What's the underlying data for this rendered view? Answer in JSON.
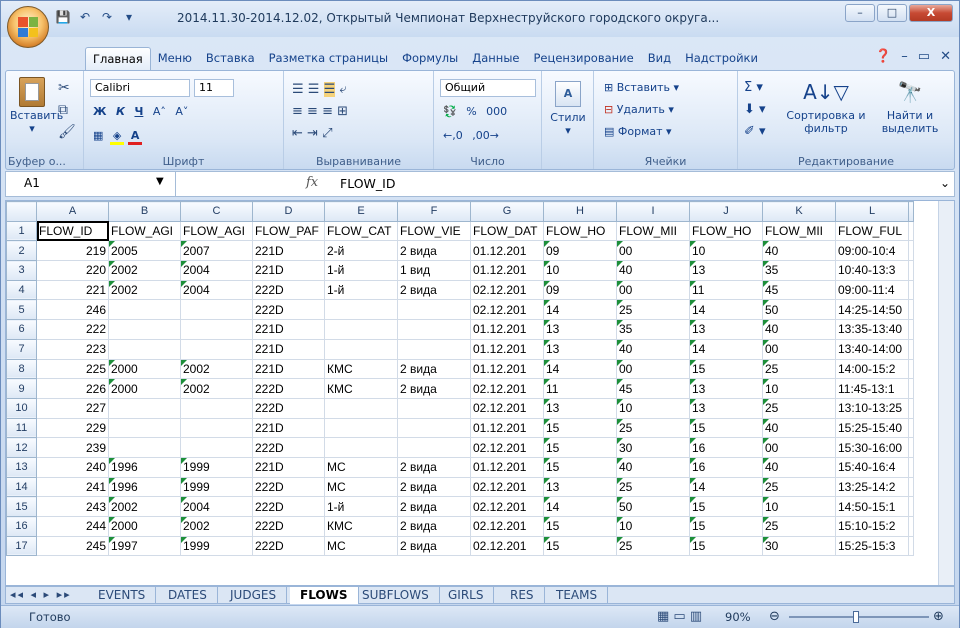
{
  "window": {
    "title": "2014.11.30-2014.12.02, Открытый Чемпионат Верхнеструйского городского округа...",
    "min": "–",
    "max": "□",
    "close": "X"
  },
  "qat": {
    "save": "💾",
    "undo": "↶",
    "redo": "↷",
    "more": "▾"
  },
  "ribbon_tabs": [
    "Главная",
    "Меню",
    "Вставка",
    "Разметка страницы",
    "Формулы",
    "Данные",
    "Рецензирование",
    "Вид",
    "Надстройки"
  ],
  "ribbon": {
    "clipboard": {
      "paste": "Вставить",
      "label": "Буфер о..."
    },
    "font": {
      "name": "Calibri",
      "size": "11",
      "bold": "Ж",
      "italic": "К",
      "underline": "Ч",
      "grow": "A˄",
      "shrink": "A˅",
      "label": "Шрифт"
    },
    "align": {
      "label": "Выравнивание"
    },
    "number": {
      "format": "Общий",
      "percent": "%",
      "thousands": "000",
      "label": "Число"
    },
    "styles": {
      "label": "Стили"
    },
    "cells": {
      "insert": "Вставить",
      "delete": "Удалить",
      "format": "Формат",
      "label": "Ячейки"
    },
    "edit": {
      "sum": "Σ",
      "sort": "Сортировка и фильтр",
      "find": "Найти и выделить",
      "label": "Редактирование"
    }
  },
  "formula_bar": {
    "name_box": "A1",
    "fx": "fx",
    "value": "FLOW_ID"
  },
  "columns": [
    "A",
    "B",
    "C",
    "D",
    "E",
    "F",
    "G",
    "H",
    "I",
    "J",
    "K",
    "L"
  ],
  "header_row": [
    "FLOW_ID",
    "FLOW_AGI",
    "FLOW_AGI",
    "FLOW_PAF",
    "FLOW_CAT",
    "FLOW_VIE",
    "FLOW_DAT",
    "FLOW_HO",
    "FLOW_MII",
    "FLOW_HO",
    "FLOW_MII",
    "FLOW_FUL"
  ],
  "rows": [
    [
      "219",
      "2005",
      "2007",
      "221D",
      "2-й",
      "2 вида",
      "01.12.201",
      "09",
      "00",
      "10",
      "40",
      "09:00-10:4"
    ],
    [
      "220",
      "2002",
      "2004",
      "221D",
      "1-й",
      "1 вид",
      "01.12.201",
      "10",
      "40",
      "13",
      "35",
      "10:40-13:3"
    ],
    [
      "221",
      "2002",
      "2004",
      "222D",
      "1-й",
      "2 вида",
      "02.12.201",
      "09",
      "00",
      "11",
      "45",
      "09:00-11:4"
    ],
    [
      "246",
      "",
      "",
      "222D",
      "",
      "",
      "02.12.201",
      "14",
      "25",
      "14",
      "50",
      "14:25-14:50"
    ],
    [
      "222",
      "",
      "",
      "221D",
      "",
      "",
      "01.12.201",
      "13",
      "35",
      "13",
      "40",
      "13:35-13:40"
    ],
    [
      "223",
      "",
      "",
      "221D",
      "",
      "",
      "01.12.201",
      "13",
      "40",
      "14",
      "00",
      "13:40-14:00"
    ],
    [
      "225",
      "2000",
      "2002",
      "221D",
      "КМС",
      "2 вида",
      "01.12.201",
      "14",
      "00",
      "15",
      "25",
      "14:00-15:2"
    ],
    [
      "226",
      "2000",
      "2002",
      "222D",
      "КМС",
      "2 вида",
      "02.12.201",
      "11",
      "45",
      "13",
      "10",
      "11:45-13:1"
    ],
    [
      "227",
      "",
      "",
      "222D",
      "",
      "",
      "02.12.201",
      "13",
      "10",
      "13",
      "25",
      "13:10-13:25"
    ],
    [
      "229",
      "",
      "",
      "221D",
      "",
      "",
      "01.12.201",
      "15",
      "25",
      "15",
      "40",
      "15:25-15:40"
    ],
    [
      "239",
      "",
      "",
      "222D",
      "",
      "",
      "02.12.201",
      "15",
      "30",
      "16",
      "00",
      "15:30-16:00"
    ],
    [
      "240",
      "1996",
      "1999",
      "221D",
      "МС",
      "2 вида",
      "01.12.201",
      "15",
      "40",
      "16",
      "40",
      "15:40-16:4"
    ],
    [
      "241",
      "1996",
      "1999",
      "222D",
      "МС",
      "2 вида",
      "02.12.201",
      "13",
      "25",
      "14",
      "25",
      "13:25-14:2"
    ],
    [
      "243",
      "2002",
      "2004",
      "222D",
      "1-й",
      "2 вида",
      "02.12.201",
      "14",
      "50",
      "15",
      "10",
      "14:50-15:1"
    ],
    [
      "244",
      "2000",
      "2002",
      "222D",
      "КМС",
      "2 вида",
      "02.12.201",
      "15",
      "10",
      "15",
      "25",
      "15:10-15:2"
    ],
    [
      "245",
      "1997",
      "1999",
      "222D",
      "МС",
      "2 вида",
      "02.12.201",
      "15",
      "25",
      "15",
      "30",
      "15:25-15:3"
    ]
  ],
  "sheet_tabs": [
    "EVENTS",
    "DATES",
    "JUDGES",
    "FLOWS",
    "SUBFLOWS",
    "GIRLS",
    "RES",
    "TEAMS"
  ],
  "active_sheet": "FLOWS",
  "status": {
    "text": "Готово",
    "zoom": "90%"
  }
}
